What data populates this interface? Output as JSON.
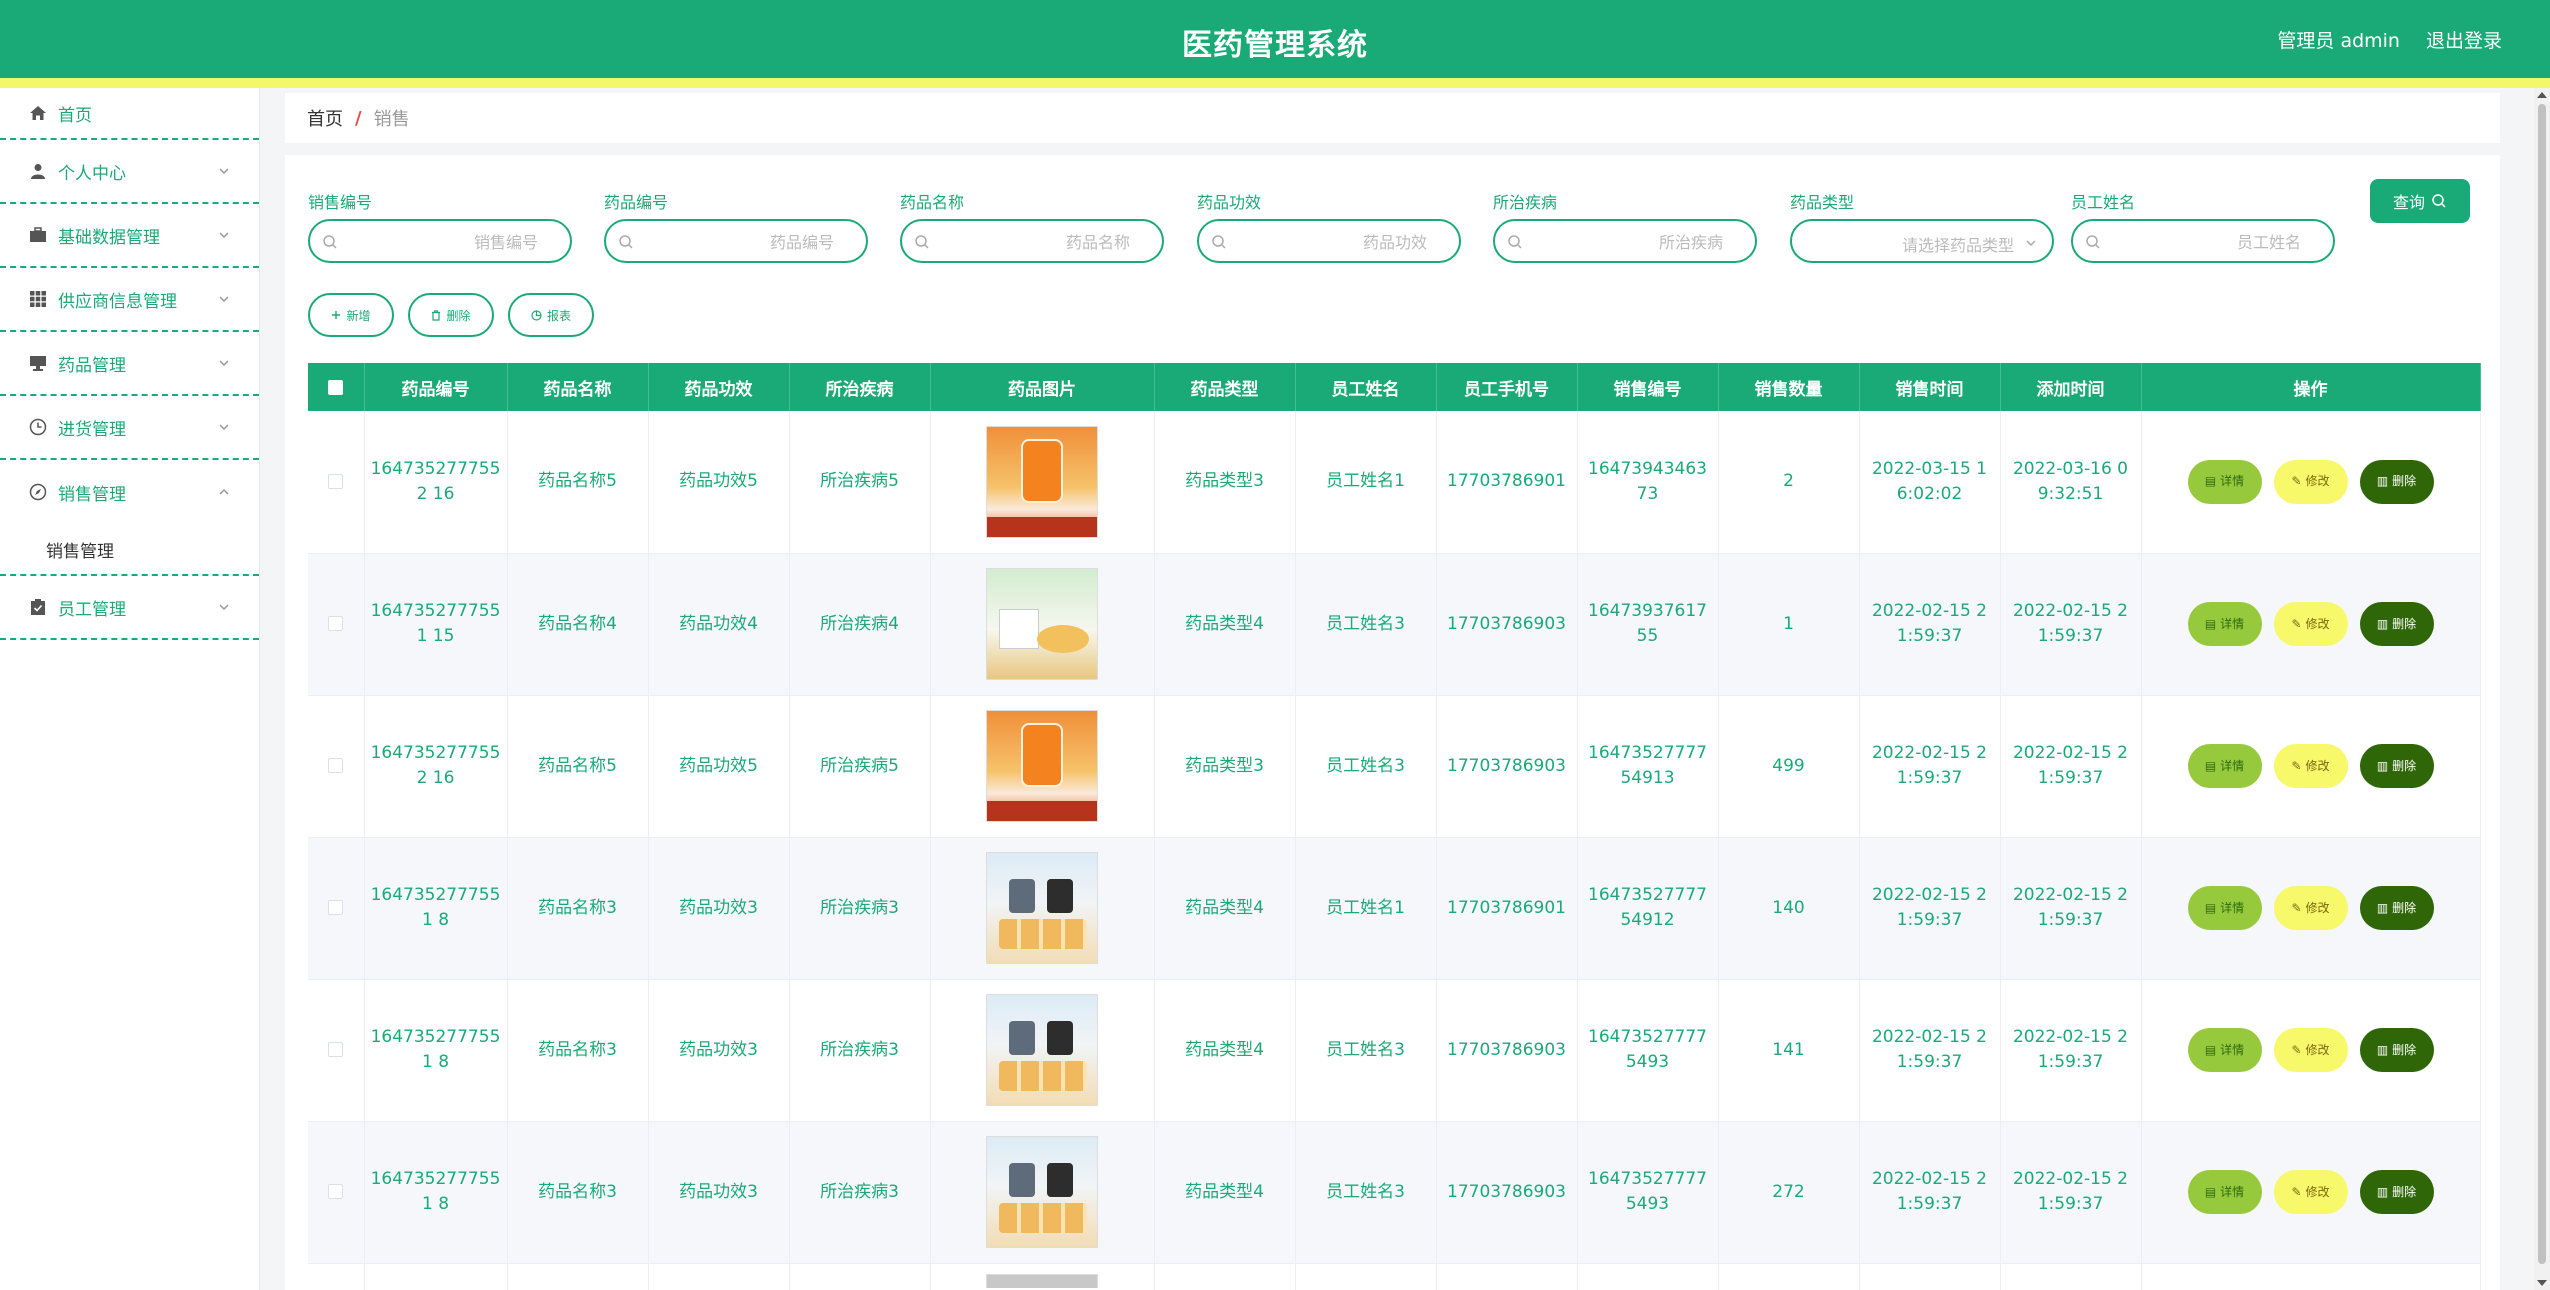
{
  "header": {
    "title": "医药管理系统",
    "user": "管理员 admin",
    "logout": "退出登录"
  },
  "sidebar": {
    "items": [
      {
        "label": "首页",
        "icon": "home-icon"
      },
      {
        "label": "个人中心",
        "icon": "user-icon"
      },
      {
        "label": "基础数据管理",
        "icon": "briefcase-icon"
      },
      {
        "label": "供应商信息管理",
        "icon": "grid-icon"
      },
      {
        "label": "药品管理",
        "icon": "monitor-icon"
      },
      {
        "label": "进货管理",
        "icon": "clock-icon"
      },
      {
        "label": "销售管理",
        "icon": "compass-icon"
      },
      {
        "label": "员工管理",
        "icon": "clipboard-icon"
      }
    ],
    "submenu": "销售管理"
  },
  "breadcrumb": {
    "home": "首页",
    "sep": "/",
    "current": "销售"
  },
  "filters": {
    "sale_no": {
      "label": "销售编号",
      "placeholder": "销售编号"
    },
    "drug_no": {
      "label": "药品编号",
      "placeholder": "药品编号"
    },
    "drug_name": {
      "label": "药品名称",
      "placeholder": "药品名称"
    },
    "effect": {
      "label": "药品功效",
      "placeholder": "药品功效"
    },
    "disease": {
      "label": "所治疾病",
      "placeholder": "所治疾病"
    },
    "type": {
      "label": "药品类型",
      "placeholder": "请选择药品类型"
    },
    "staff": {
      "label": "员工姓名",
      "placeholder": "员工姓名"
    },
    "query": "查询"
  },
  "actions": {
    "add": "新增",
    "delete": "删除",
    "report": "报表"
  },
  "table": {
    "headers": [
      "药品编号",
      "药品名称",
      "药品功效",
      "所治疾病",
      "药品图片",
      "药品类型",
      "员工姓名",
      "员工手机号",
      "销售编号",
      "销售数量",
      "销售时间",
      "添加时间",
      "操作"
    ],
    "rows": [
      {
        "drug_no": "1647352777552 16",
        "name": "药品名称5",
        "effect": "药品功效5",
        "disease": "所治疾病5",
        "img": "orange",
        "type": "药品类型3",
        "staff": "员工姓名1",
        "phone": "17703786901",
        "sale_no": "1647394346373",
        "qty": "2",
        "sale_time": "2022-03-15 16:02:02",
        "add_time": "2022-03-16 09:32:51"
      },
      {
        "drug_no": "1647352777551 15",
        "name": "药品名称4",
        "effect": "药品功效4",
        "disease": "所治疾病4",
        "img": "green",
        "type": "药品类型4",
        "staff": "员工姓名3",
        "phone": "17703786903",
        "sale_no": "1647393761755",
        "qty": "1",
        "sale_time": "2022-02-15 21:59:37",
        "add_time": "2022-02-15 21:59:37"
      },
      {
        "drug_no": "1647352777552 16",
        "name": "药品名称5",
        "effect": "药品功效5",
        "disease": "所治疾病5",
        "img": "orange",
        "type": "药品类型3",
        "staff": "员工姓名3",
        "phone": "17703786903",
        "sale_no": "1647352777754913",
        "qty": "499",
        "sale_time": "2022-02-15 21:59:37",
        "add_time": "2022-02-15 21:59:37"
      },
      {
        "drug_no": "1647352777551 8",
        "name": "药品名称3",
        "effect": "药品功效3",
        "disease": "所治疾病3",
        "img": "blue",
        "type": "药品类型4",
        "staff": "员工姓名1",
        "phone": "17703786901",
        "sale_no": "1647352777754912",
        "qty": "140",
        "sale_time": "2022-02-15 21:59:37",
        "add_time": "2022-02-15 21:59:37"
      },
      {
        "drug_no": "1647352777551 8",
        "name": "药品名称3",
        "effect": "药品功效3",
        "disease": "所治疾病3",
        "img": "blue",
        "type": "药品类型4",
        "staff": "员工姓名3",
        "phone": "17703786903",
        "sale_no": "164735277775493",
        "qty": "141",
        "sale_time": "2022-02-15 21:59:37",
        "add_time": "2022-02-15 21:59:37"
      },
      {
        "drug_no": "1647352777551 8",
        "name": "药品名称3",
        "effect": "药品功效3",
        "disease": "所治疾病3",
        "img": "blue",
        "type": "药品类型4",
        "staff": "员工姓名3",
        "phone": "17703786903",
        "sale_no": "164735277775493",
        "qty": "272",
        "sale_time": "2022-02-15 21:59:37",
        "add_time": "2022-02-15 21:59:37"
      }
    ],
    "op": {
      "detail": "详情",
      "edit": "修改",
      "delete": "删除"
    }
  },
  "colors": {
    "primary": "#1aaa77",
    "accent_strip": "#f3f86a",
    "detail_btn": "#97c93c",
    "edit_btn": "#f7f86a",
    "delete_btn": "#2e6608"
  }
}
